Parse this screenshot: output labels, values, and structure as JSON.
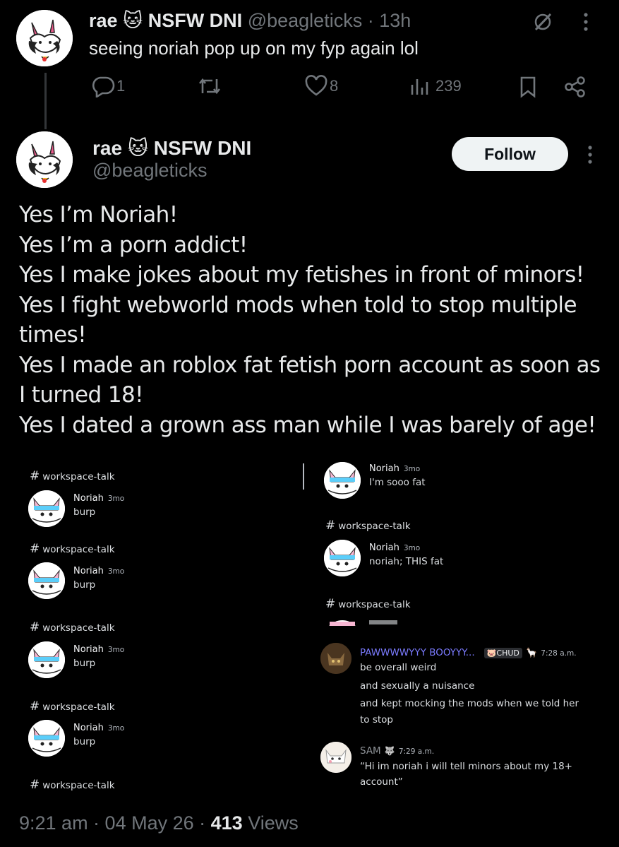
{
  "top_post": {
    "name": "rae 🐱 NSFW DNI",
    "handle": "@beagleticks",
    "time": "· 13h",
    "text": "seeing noriah pop up on my fyp again lol",
    "replies": "1",
    "reposts": "",
    "likes": "8",
    "views": "239"
  },
  "main_post": {
    "name": "rae 🐱 NSFW DNI",
    "handle": "@beagleticks",
    "follow_label": "Follow",
    "lines": [
      "Yes I’m Noriah!",
      "Yes I’m a porn addict!",
      "Yes I make jokes about my fetishes in front of minors!",
      "Yes I fight webworld mods when told to stop multiple",
      "times!",
      "Yes I made an roblox fat fetish porn account as soon as",
      "I turned 18!",
      "Yes I dated a grown ass man while I was barely of age!"
    ],
    "footer_time": "9:21 am · 04 May 26 ·",
    "footer_views_count": "413",
    "footer_views_label": "Views"
  },
  "embed": {
    "channel": "workspace-talk",
    "hash": "#",
    "left_messages": [
      {
        "user": "Noriah",
        "time": "3mo",
        "text": "burp"
      },
      {
        "user": "Noriah",
        "time": "3mo",
        "text": "burp"
      },
      {
        "user": "Noriah",
        "time": "3mo",
        "text": "burp"
      },
      {
        "user": "Noriah",
        "time": "3mo",
        "text": "burp"
      }
    ],
    "right_messages": [
      {
        "user": "Noriah",
        "time": "3mo",
        "text": "I'm sooo fat"
      },
      {
        "user": "Noriah",
        "time": "3mo",
        "text": "noriah; THIS fat"
      }
    ],
    "chat1": {
      "user": "PAWWWWYYY BOOYYY...",
      "tag": "CHUD",
      "time": "7:28 a.m.",
      "lines": [
        "be overall weird",
        "and sexually a nuisance",
        "and kept mocking the mods when we told her",
        "to stop"
      ]
    },
    "chat2": {
      "user": "SAM",
      "time": "7:29 a.m.",
      "lines": [
        "“Hi im noriah i will tell minors about my 18+",
        "account”"
      ]
    },
    "chat1_user_color": "#7b7bff",
    "chat2_user_color": "#8e9297"
  },
  "colors": {
    "background": "#000000",
    "text": "#e7e9ea",
    "secondary": "#71767b"
  },
  "icons": [
    "reply-icon",
    "repost-icon",
    "like-icon",
    "views-icon",
    "bookmark-icon",
    "share-icon",
    "grok-icon",
    "more-icon"
  ]
}
